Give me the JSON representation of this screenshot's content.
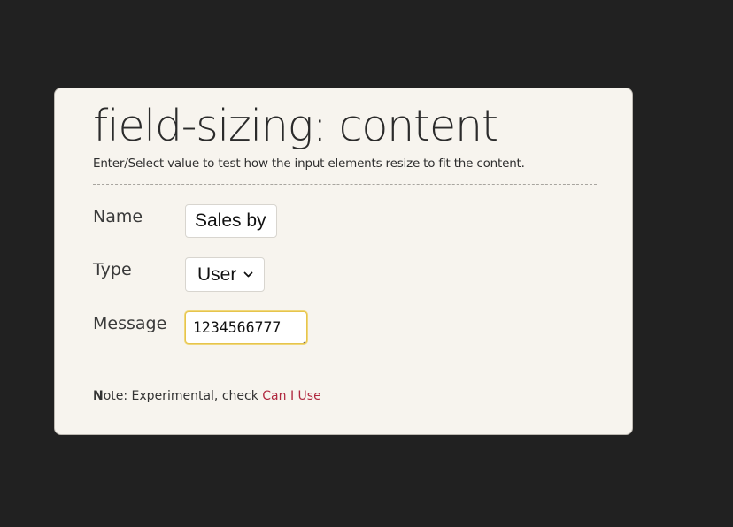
{
  "page": {
    "title": "field-sizing: content",
    "subtitle": "Enter/Select value to test how the input elements resize to fit the content."
  },
  "form": {
    "name": {
      "label": "Name",
      "value": "Sales by"
    },
    "type": {
      "label": "Type",
      "selected": "User"
    },
    "message": {
      "label": "Message",
      "value": "1234566777"
    }
  },
  "note": {
    "prefix": "N",
    "text": "ote: Experimental, check ",
    "link_text": "Can I Use"
  },
  "colors": {
    "background": "#212121",
    "card": "#f7f4ee",
    "link": "#b0283f",
    "focus_border": "#e6c44c"
  },
  "icons": {
    "select_arrow": "chevron-down-icon",
    "textarea_grip": "resize-grip-icon"
  }
}
